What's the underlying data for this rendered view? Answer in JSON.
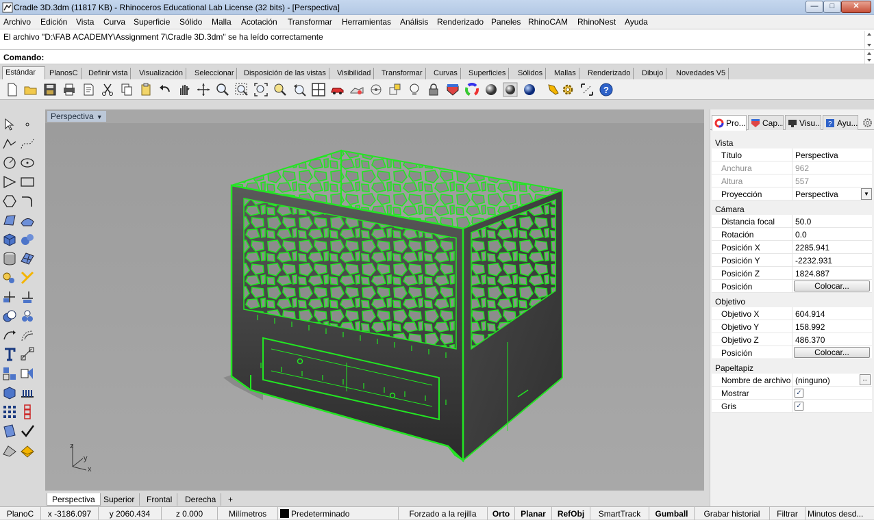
{
  "titlebar": {
    "title": "Cradle 3D.3dm (11817 KB) - Rhinoceros Educational Lab License (32 bits) - [Perspectiva]"
  },
  "menu": [
    "Archivo",
    "Edición",
    "Vista",
    "Curva",
    "Superficie",
    "Sólido",
    "Malla",
    "Acotación",
    "Transformar",
    "Herramientas",
    "Análisis",
    "Renderizado",
    "Paneles",
    "RhinoCAM",
    "RhinoNest",
    "Ayuda"
  ],
  "history": {
    "message": "El archivo \"D:\\FAB ACADEMY\\Assignment 7\\Cradle 3D.3dm\" se ha leído correctamente"
  },
  "command": {
    "label": "Comando:"
  },
  "toolbar_tabs": [
    "Estándar",
    "PlanosC",
    "Definir vista",
    "Visualización",
    "Seleccionar",
    "Disposición de las vistas",
    "Visibilidad",
    "Transformar",
    "Curvas",
    "Superficies",
    "Sólidos",
    "Mallas",
    "Renderizado",
    "Dibujo",
    "Novedades V5"
  ],
  "viewport": {
    "title": "Perspectiva"
  },
  "axes": {
    "z": "z",
    "y": "y",
    "x": "x"
  },
  "view_tabs": [
    "Perspectiva",
    "Superior",
    "Frontal",
    "Derecha",
    "+"
  ],
  "panel_tabs": [
    "Pro...",
    "Cap...",
    "Visu...",
    "Ayu..."
  ],
  "properties": {
    "vista_section": "Vista",
    "titulo_label": "Título",
    "titulo_value": "Perspectiva",
    "anchura_label": "Anchura",
    "anchura_value": "962",
    "altura_label": "Altura",
    "altura_value": "557",
    "proyeccion_label": "Proyección",
    "proyeccion_value": "Perspectiva",
    "camara_section": "Cámara",
    "distancia_label": "Distancia focal",
    "distancia_value": "50.0",
    "rotacion_label": "Rotación",
    "rotacion_value": "0.0",
    "posx_label": "Posición X",
    "posx_value": "2285.941",
    "posy_label": "Posición Y",
    "posy_value": "-2232.931",
    "posz_label": "Posición Z",
    "posz_value": "1824.887",
    "posicion_label": "Posición",
    "colocar_label": "Colocar...",
    "objetivo_section": "Objetivo",
    "objx_label": "Objetivo X",
    "objx_value": "604.914",
    "objy_label": "Objetivo Y",
    "objy_value": "158.992",
    "objz_label": "Objetivo Z",
    "objz_value": "486.370",
    "posicion2_label": "Posición",
    "colocar2_label": "Colocar...",
    "papel_section": "Papeltapiz",
    "nombre_label": "Nombre de archivo",
    "nombre_value": "(ninguno)",
    "mostrar_label": "Mostrar",
    "mostrar_checked": true,
    "gris_label": "Gris",
    "gris_checked": true,
    "dots_label": "..."
  },
  "status": {
    "cplane": "PlanoC",
    "x": "x -3186.097",
    "y": "y 2060.434",
    "z": "z 0.000",
    "units": "Milímetros",
    "layer": "Predeterminado",
    "grid_snap": "Forzado a la rejilla",
    "ortho": "Orto",
    "planar": "Planar",
    "osnap": "RefObj",
    "smarttrack": "SmartTrack",
    "gumball": "Gumball",
    "history": "Grabar historial",
    "filter": "Filtrar",
    "minutes": "Minutos desd..."
  },
  "colors": {
    "selection": "#22e622",
    "model_dark": "#353535",
    "viewport_bg": "#a0a0a0"
  }
}
